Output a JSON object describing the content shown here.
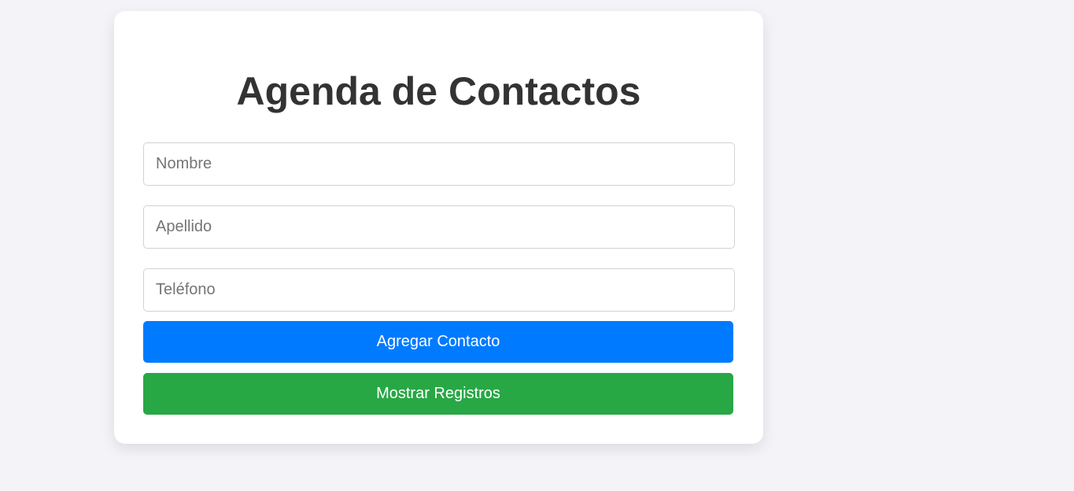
{
  "form": {
    "title": "Agenda de Contactos",
    "fields": {
      "nombre": {
        "placeholder": "Nombre",
        "value": ""
      },
      "apellido": {
        "placeholder": "Apellido",
        "value": ""
      },
      "telefono": {
        "placeholder": "Teléfono",
        "value": ""
      }
    },
    "buttons": {
      "add_label": "Agregar Contacto",
      "add_color": "#007bff",
      "show_label": "Mostrar Registros",
      "show_color": "#28a745"
    }
  }
}
